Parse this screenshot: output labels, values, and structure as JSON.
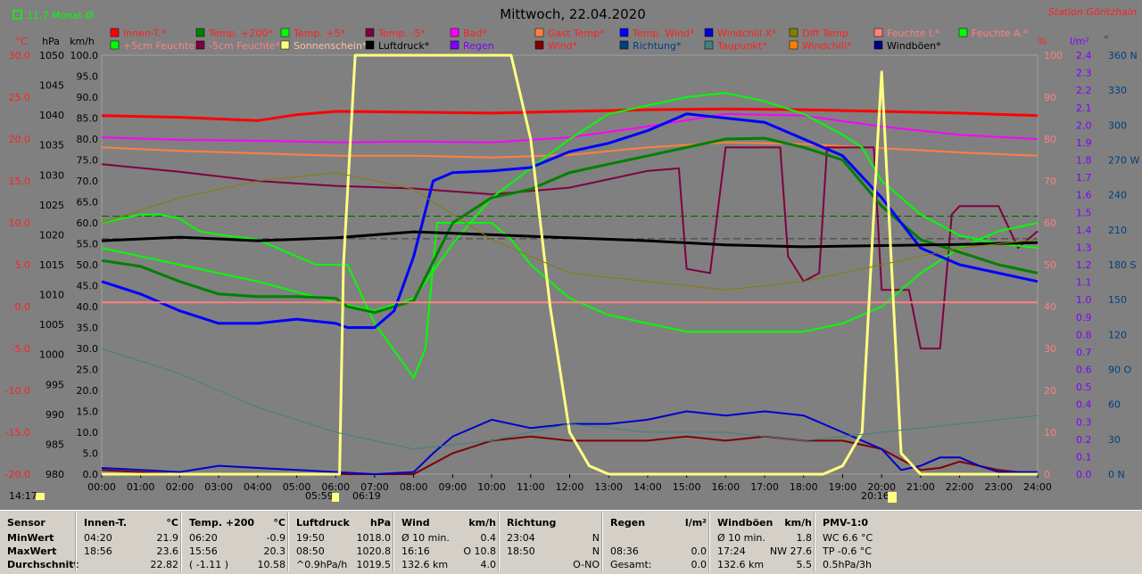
{
  "header": {
    "title": "Mittwoch, 22.04.2020",
    "station": "Station Göritzhain",
    "month_avg": "11.7 Monat-Ø"
  },
  "units": {
    "temp": "°C",
    "pressure": "hPa",
    "speed": "km/h",
    "percent": "%",
    "rain": "l/m²",
    "degree": "°"
  },
  "legend_row1": [
    {
      "label": "Innen-T.*",
      "color": "#ff0000",
      "text_color": "#ff2020"
    },
    {
      "label": "Temp. +200*",
      "color": "#008000",
      "text_color": "#ff2020"
    },
    {
      "label": "Temp. +5*",
      "color": "#00ff00",
      "text_color": "#ff2020"
    },
    {
      "label": "Temp. -5*",
      "color": "#800040",
      "text_color": "#ff2020"
    },
    {
      "label": "Bad*",
      "color": "#ff00ff",
      "text_color": "#ff2020"
    },
    {
      "label": "Gast Temp*",
      "color": "#ff8040",
      "text_color": "#ff2020"
    },
    {
      "label": "Temp. Wind*",
      "color": "#0000ff",
      "text_color": "#ff2020"
    },
    {
      "label": "Windchill X*",
      "color": "#0000cc",
      "text_color": "#ff2020"
    },
    {
      "label": "Diff Temp.",
      "color": "#808000",
      "text_color": "#ff2020"
    },
    {
      "label": "Feuchte I.*",
      "color": "#ff8080",
      "text_color": "#ff8080"
    },
    {
      "label": "Feuchte A.*",
      "color": "#00ff00",
      "text_color": "#ff8080"
    }
  ],
  "legend_row2": [
    {
      "label": "+5cm Feuchte*",
      "color": "#00ff00",
      "text_color": "#ff8080"
    },
    {
      "label": "-5cm Feuchte*",
      "color": "#800040",
      "text_color": "#ff8080"
    },
    {
      "label": "Sonnenschein*",
      "color": "#ffff80",
      "text_color": "#ffc0a0"
    },
    {
      "label": "Luftdruck*",
      "color": "#000000",
      "text_color": "#000000"
    },
    {
      "label": "Regen",
      "color": "#8000ff",
      "text_color": "#8000ff"
    },
    {
      "label": "Wind*",
      "color": "#800000",
      "text_color": "#ff2020"
    },
    {
      "label": "Richtung*",
      "color": "#004080",
      "text_color": "#004080"
    },
    {
      "label": "Taupunkt*",
      "color": "#408080",
      "text_color": "#ff2020"
    },
    {
      "label": "Windchill*",
      "color": "#ff8000",
      "text_color": "#ff2020"
    },
    {
      "label": "Windböen*",
      "color": "#000080",
      "text_color": "#000000"
    }
  ],
  "sun_markers": {
    "sunrise_small": "05:59",
    "sunrise": "06:19",
    "sunset": "20:16",
    "left_marker": "14:17"
  },
  "chart_data": {
    "type": "line",
    "title": "Mittwoch, 22.04.2020",
    "x_ticks": [
      "00:00",
      "01:00",
      "02:00",
      "03:00",
      "04:00",
      "05:00",
      "06:00",
      "07:00",
      "08:00",
      "09:00",
      "10:00",
      "11:00",
      "12:00",
      "13:00",
      "14:00",
      "15:00",
      "16:00",
      "17:00",
      "18:00",
      "19:00",
      "20:00",
      "21:00",
      "22:00",
      "23:00",
      "24:00"
    ],
    "axes": {
      "temp_c": [
        "30.0",
        "25.0",
        "20.0",
        "15.0",
        "10.0",
        "5.0",
        "0.0",
        "-5.0",
        "-10.0",
        "-15.0",
        "-20.0"
      ],
      "hpa": [
        "1050",
        "1045",
        "1040",
        "1035",
        "1030",
        "1025",
        "1020",
        "1015",
        "1010",
        "1005",
        "1000",
        "995",
        "990",
        "985",
        "980"
      ],
      "kmh": [
        "100.0",
        "95.0",
        "90.0",
        "85.0",
        "80.0",
        "75.0",
        "70.0",
        "65.0",
        "60.0",
        "55.0",
        "50.0",
        "45.0",
        "40.0",
        "35.0",
        "30.0",
        "25.0",
        "20.0",
        "15.0",
        "10.0",
        "5.0",
        "0.0"
      ],
      "percent": [
        "100",
        "90",
        "80",
        "70",
        "60",
        "50",
        "40",
        "30",
        "20",
        "10",
        "0"
      ],
      "rain": [
        "2.4",
        "2.3",
        "2.2",
        "2.1",
        "2.0",
        "1.9",
        "1.8",
        "1.7",
        "1.6",
        "1.5",
        "1.4",
        "1.3",
        "1.2",
        "1.1",
        "1.0",
        "0.9",
        "0.8",
        "0.7",
        "0.6",
        "0.5",
        "0.4",
        "0.3",
        "0.2",
        "0.1",
        "0.0"
      ],
      "wind_dir": [
        "360 N",
        "330",
        "300",
        "270 W",
        "240",
        "210",
        "180 S",
        "150",
        "120",
        "90 O",
        "60",
        "30",
        "0 N"
      ]
    },
    "series": [
      {
        "name": "Innen-T.*",
        "color": "#ff0000",
        "width": 3,
        "x": [
          0,
          2,
          4,
          5,
          6,
          8,
          10,
          12,
          14,
          16,
          18,
          20,
          22,
          24
        ],
        "y": [
          22.8,
          22.6,
          22.2,
          22.9,
          23.3,
          23.2,
          23.1,
          23.3,
          23.5,
          23.6,
          23.5,
          23.3,
          23.1,
          22.8
        ]
      },
      {
        "name": "Bad*",
        "color": "#ff00ff",
        "width": 2,
        "x": [
          0,
          2,
          4,
          6,
          8,
          10,
          12,
          14,
          16,
          18,
          20,
          22,
          24
        ],
        "y": [
          20.2,
          19.9,
          19.8,
          19.6,
          19.7,
          19.6,
          20.2,
          21.5,
          23.0,
          22.8,
          21.5,
          20.5,
          20.0
        ]
      },
      {
        "name": "Gast Temp*",
        "color": "#ff8040",
        "width": 2,
        "x": [
          0,
          2,
          4,
          6,
          8,
          10,
          12,
          14,
          16,
          18,
          20,
          22,
          24
        ],
        "y": [
          19.0,
          18.6,
          18.3,
          18.0,
          18.0,
          17.8,
          18.1,
          19.0,
          19.6,
          19.4,
          18.9,
          18.4,
          18.0
        ]
      },
      {
        "name": "Temp. -5*",
        "color": "#800040",
        "width": 2,
        "x": [
          0,
          2,
          4,
          6,
          8,
          10,
          12,
          13,
          14,
          14.8,
          15,
          15.6,
          16,
          17.4,
          17.6,
          18,
          18.4,
          18.6,
          19.8,
          20,
          20.7,
          21,
          21.5,
          21.8,
          22,
          23,
          23.5,
          24
        ],
        "y": [
          17.0,
          16.1,
          15.0,
          14.4,
          14.1,
          13.4,
          14.2,
          15.2,
          16.2,
          16.5,
          4.5,
          4,
          19,
          19,
          6,
          3,
          4,
          19,
          19,
          2,
          2,
          -5,
          -5,
          11,
          12,
          12,
          7,
          9
        ]
      },
      {
        "name": "Temp. +5*",
        "color": "#00ff00",
        "width": 2,
        "x": [
          0,
          0.5,
          1,
          1.5,
          2,
          2.5,
          3,
          4,
          5,
          5.5,
          6,
          6.3,
          7,
          8,
          8.3,
          8.6,
          9,
          10,
          10.5,
          11,
          11.5,
          12,
          13,
          14,
          15,
          16,
          17,
          18,
          19,
          20,
          21,
          22,
          23,
          24
        ],
        "y": [
          10,
          10.5,
          11,
          11,
          10.5,
          9,
          8.6,
          8,
          6,
          5,
          5,
          5,
          -2,
          -8.5,
          -5,
          10,
          10,
          10,
          8,
          5,
          3,
          1,
          -1,
          -2,
          -3,
          -3,
          -3,
          -3,
          -2,
          0,
          4,
          7,
          9,
          10
        ]
      },
      {
        "name": "Feuchte A.*",
        "color": "#00ff00",
        "width": 2,
        "x": [
          0,
          2,
          4,
          6,
          6.5,
          7,
          8,
          9,
          10,
          11,
          12,
          13,
          14,
          15,
          16,
          17,
          18,
          19,
          19.5,
          20,
          21,
          22,
          23,
          24
        ],
        "y": [
          54,
          50,
          46,
          41,
          40,
          39,
          42,
          55,
          66,
          73,
          80,
          86,
          88,
          90,
          91,
          89,
          86,
          81,
          78,
          70,
          62,
          57,
          55,
          54
        ]
      },
      {
        "name": "Temp. +200*",
        "color": "#008000",
        "width": 3,
        "x": [
          0,
          1,
          2,
          3,
          4,
          5,
          6,
          6.3,
          7,
          8,
          9,
          10,
          11,
          12,
          13,
          14,
          15,
          16,
          17,
          18,
          19,
          20,
          21,
          22,
          23,
          24
        ],
        "y": [
          5.5,
          4.8,
          3,
          1.5,
          1.2,
          1.2,
          1.0,
          0.0,
          -0.7,
          0.7,
          10,
          13,
          14,
          16,
          17,
          18,
          19,
          20,
          20.1,
          19,
          17.5,
          12,
          8,
          6.5,
          5,
          4
        ]
      },
      {
        "name": "Temp. Wind*",
        "color": "#0000ff",
        "width": 3,
        "x": [
          0,
          1,
          2,
          3,
          4,
          5,
          6,
          6.3,
          7,
          7.5,
          8,
          8.5,
          9,
          10,
          11,
          12,
          13,
          14,
          15,
          16,
          17,
          18,
          19,
          20,
          21,
          22,
          23,
          24
        ],
        "y": [
          3,
          1.5,
          -0.5,
          -2,
          -2,
          -1.5,
          -2,
          -2.5,
          -2.5,
          -0.5,
          6,
          15,
          16,
          16.2,
          16.6,
          18.5,
          19.5,
          21,
          23,
          22.5,
          22,
          20,
          18,
          13,
          7,
          5,
          4,
          3
        ]
      },
      {
        "name": "Luftdruck*",
        "color": "#000000",
        "width": 3,
        "x": [
          0,
          2,
          4,
          6,
          8,
          10,
          12,
          14,
          16,
          18,
          20,
          22,
          24
        ],
        "y": [
          1019.0,
          1019.6,
          1019.0,
          1019.5,
          1020.5,
          1020.0,
          1019.5,
          1019.0,
          1018.3,
          1018.0,
          1018.2,
          1018.4,
          1018.7
        ]
      },
      {
        "name": "Wind*",
        "color": "#800000",
        "width": 2,
        "x": [
          0,
          1,
          2,
          4,
          5,
          6,
          7,
          8,
          9,
          10,
          11,
          12,
          13,
          14,
          15,
          16,
          17,
          18,
          19,
          20,
          21,
          21.5,
          22,
          22.5,
          23,
          24
        ],
        "y": [
          1,
          0.5,
          0,
          0,
          0,
          0,
          0,
          0,
          5,
          8,
          9,
          8,
          8,
          8,
          9,
          8,
          9,
          8,
          8,
          6,
          1,
          1.5,
          3,
          2,
          1,
          0
        ]
      },
      {
        "name": "Windböen*",
        "color": "#0000cc",
        "width": 2,
        "x": [
          0,
          1,
          2,
          3,
          4,
          5,
          6,
          7,
          8,
          8.5,
          9,
          10,
          11,
          12,
          13,
          14,
          15,
          16,
          17,
          18,
          19,
          20,
          20.5,
          21,
          21.5,
          22,
          22.5,
          23,
          24
        ],
        "y": [
          1.5,
          1,
          0.5,
          2,
          1.5,
          1,
          0.5,
          0,
          0.5,
          5,
          9,
          13,
          11,
          12,
          12,
          13,
          15,
          14,
          15,
          14,
          10,
          6,
          1,
          2,
          4,
          4,
          2,
          0.5,
          0.5
        ]
      },
      {
        "name": "Feuchte I.*",
        "color": "#ff8080",
        "width": 2,
        "x": [
          0,
          6,
          8,
          10,
          12,
          14,
          16,
          18,
          20,
          24
        ],
        "y": [
          41,
          41,
          41,
          41,
          41,
          41,
          41,
          41,
          41,
          41
        ]
      },
      {
        "name": "Sonnenschein*",
        "color": "#ffff80",
        "width": 3,
        "x": [
          0,
          6.1,
          6.2,
          6.5,
          10.5,
          11,
          11.5,
          12,
          12.5,
          13,
          18.5,
          19,
          19.5,
          19.9,
          20,
          20.5,
          21,
          24
        ],
        "y": [
          0,
          0,
          50,
          100,
          100,
          80,
          40,
          10,
          2,
          0,
          0,
          2,
          10,
          80,
          96,
          5,
          0,
          0
        ]
      },
      {
        "name": "Taupunkt*",
        "color": "#408080",
        "width": 1,
        "x": [
          0,
          2,
          4,
          6,
          7,
          8,
          10,
          12,
          14,
          16,
          18,
          20,
          22,
          24
        ],
        "y": [
          -5,
          -8,
          -12,
          -15,
          -16,
          -17,
          -16,
          -14,
          -15,
          -15,
          -16,
          -15,
          -14,
          -13
        ]
      },
      {
        "name": "Diff Temp.",
        "color": "#808000",
        "width": 1,
        "x": [
          0,
          2,
          4,
          6,
          8,
          10,
          12,
          14,
          16,
          18,
          20,
          22,
          24
        ],
        "y": [
          10,
          13,
          15,
          16,
          14,
          8,
          4,
          3,
          2,
          3,
          5,
          7,
          8
        ]
      }
    ],
    "ylim_temp": [
      -20,
      30
    ]
  },
  "stats": {
    "columns": [
      {
        "header": "Sensor",
        "unit": "",
        "rows": [
          {
            "label": "MinWert"
          },
          {
            "label": "MaxWert"
          },
          {
            "label": "Durchschnitt"
          }
        ]
      },
      {
        "header": "Innen-T.",
        "unit": "°C",
        "rows": [
          {
            "time": "04:20",
            "value": "21.9"
          },
          {
            "time": "18:56",
            "value": "23.6"
          },
          {
            "time": "",
            "value": "22.82"
          }
        ]
      },
      {
        "header": "Temp. +200",
        "unit": "°C",
        "rows": [
          {
            "time": "06:20",
            "value": "-0.9"
          },
          {
            "time": "15:56",
            "value": "20.3"
          },
          {
            "time": "( -1.11 )",
            "value": "10.58"
          }
        ]
      },
      {
        "header": "Luftdruck",
        "unit": "hPa",
        "rows": [
          {
            "time": "19:50",
            "value": "1018.0"
          },
          {
            "time": "08:50",
            "value": "1020.8"
          },
          {
            "time": "^0.9hPa/h",
            "value": "1019.5"
          }
        ]
      },
      {
        "header": "Wind",
        "unit": "km/h",
        "rows": [
          {
            "time": "Ø 10 min.",
            "value": "0.4"
          },
          {
            "time": "16:16",
            "value": "O 10.8"
          },
          {
            "time": "132.6 km",
            "value": "4.0"
          }
        ]
      },
      {
        "header": "Richtung",
        "unit": "",
        "rows": [
          {
            "time": "23:04",
            "value": "N"
          },
          {
            "time": "18:50",
            "value": "N"
          },
          {
            "time": "",
            "value": "O-NO"
          }
        ]
      },
      {
        "header": "Regen",
        "unit": "l/m²",
        "rows": [
          {
            "time": "",
            "value": ""
          },
          {
            "time": "08:36",
            "value": "0.0"
          },
          {
            "time": "Gesamt:",
            "value": "0.0"
          }
        ]
      },
      {
        "header": "Windböen",
        "unit": "km/h",
        "rows": [
          {
            "time": "Ø 10 min.",
            "value": "1.8"
          },
          {
            "time": "17:24",
            "value": "NW 27.6"
          },
          {
            "time": "132.6 km",
            "value": "5.5"
          }
        ]
      },
      {
        "header": "PMV-1:0",
        "unit": "",
        "rows": [
          {
            "time": "WC 6.6 °C",
            "value": ""
          },
          {
            "time": "TP -0.6 °C",
            "value": ""
          },
          {
            "time": "0.5hPa/3h",
            "value": ""
          }
        ]
      }
    ]
  }
}
